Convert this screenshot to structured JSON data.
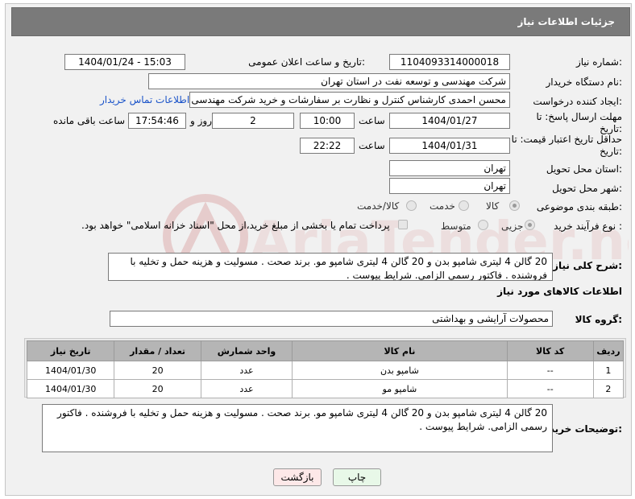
{
  "header": {
    "title": "جزئیات اطلاعات نیاز"
  },
  "form": {
    "need_number_label": "شماره نیاز:",
    "need_number": "1104093314000018",
    "announce_label": "تاریخ و ساعت اعلان عمومی:",
    "announce_value": "1404/01/24 - 15:03",
    "buyer_org_label": "نام دستگاه خریدار:",
    "buyer_org": "شرکت مهندسی و توسعه نفت در استان تهران",
    "creator_label": "ایجاد کننده درخواست:",
    "creator": "محسن احمدی کارشناس کنترل و نظارت بر سفارشات و خرید شرکت مهندسی و توسعه نفت",
    "contact_link": "اطلاعات تماس خریدار",
    "deadline_label": "مهلت ارسال پاسخ: تا تاریخ:",
    "deadline_date": "1404/01/27",
    "time_label": "ساعت",
    "deadline_time": "10:00",
    "days_value": "2",
    "days_label": "روز و",
    "remaining_time": "17:54:46",
    "remaining_label": "ساعت باقی مانده",
    "validity_label": "حداقل تاریخ اعتبار قیمت: تا تاریخ:",
    "validity_date": "1404/01/31",
    "validity_time_label": "ساعت",
    "validity_time": "22:22",
    "province_label": "استان محل تحویل:",
    "province": "تهران",
    "city_label": "شهر محل تحویل:",
    "city": "تهران",
    "category_label": "طبقه بندی موضوعی:",
    "category_options": [
      "کالا",
      "خدمت",
      "کالا/خدمت"
    ],
    "process_label": "نوع فرآیند خرید :",
    "process_options": [
      "جزیی",
      "متوسط"
    ],
    "payment_note": "پرداخت تمام یا بخشی از مبلغ خرید،از محل \"اسناد خزانه اسلامی\" خواهد بود."
  },
  "summary": {
    "label": "شرح کلی نیاز:",
    "text": "20 گالن 4 لیتری شامپو بدن و 20 گالن 4 لیتری شامپو مو.  برند صحت . مسولیت و هزینه حمل و تخلیه با فروشنده . فاکتور رسمی الزامی. شرایط پیوست ."
  },
  "goods": {
    "section_title": "اطلاعات کالاهای مورد نیاز",
    "group_label": "گروه کالا:",
    "group_value": "محصولات آرایشی و بهداشتی",
    "columns": [
      "ردیف",
      "کد کالا",
      "نام کالا",
      "واحد شمارش",
      "تعداد / مقدار",
      "تاریخ نیاز"
    ],
    "rows": [
      {
        "row": "1",
        "code": "--",
        "name": "شامپو بدن",
        "unit": "عدد",
        "qty": "20",
        "date": "1404/01/30"
      },
      {
        "row": "2",
        "code": "--",
        "name": "شامپو مو",
        "unit": "عدد",
        "qty": "20",
        "date": "1404/01/30"
      }
    ]
  },
  "buyer_notes": {
    "label": "توضیحات خریدار:",
    "text": "20 گالن 4 لیتری شامپو بدن و 20 گالن 4 لیتری شامپو مو.  برند صحت . مسولیت و هزینه حمل و تخلیه با فروشنده . فاکتور رسمی الزامی. شرایط پیوست ."
  },
  "buttons": {
    "print": "چاپ",
    "back": "بازگشت"
  },
  "watermark_text": "AriaTender.neT",
  "colors": {
    "header_bg": "#7a7a7a",
    "link": "#1a53c9",
    "watermark": "#e3c9c9"
  }
}
